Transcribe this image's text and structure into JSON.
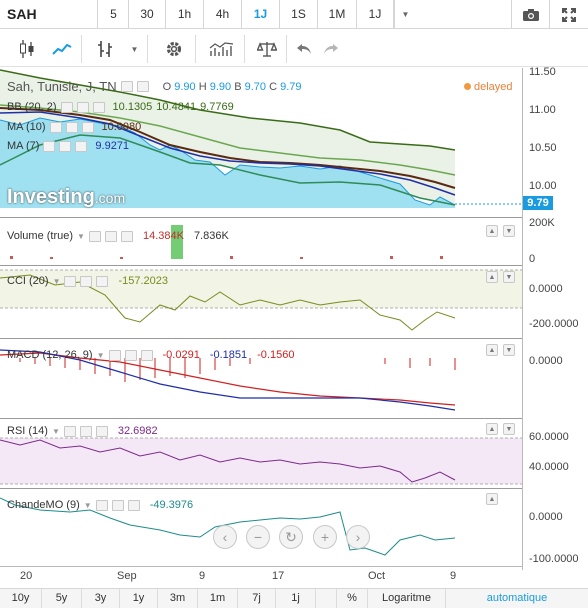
{
  "symbol": "SAH",
  "timeframes": [
    "5",
    "30",
    "1h",
    "4h",
    "1J",
    "1S",
    "1M",
    "1J"
  ],
  "active_timeframe_index": 4,
  "main": {
    "title": "Sah, Tunisie, J, TN",
    "ohlc": {
      "o_label": "O",
      "o": "9.90",
      "h_label": "H",
      "h": "9.90",
      "b_label": "B",
      "b": "9.70",
      "c_label": "C",
      "c": "9.79"
    },
    "delayed": "delayed",
    "bb_label": "BB (20, 2)",
    "bb_values": [
      "10.1305",
      "10.4841",
      "9.7769"
    ],
    "ma10_label": "MA (10)",
    "ma10_value": "10.0080",
    "ma7_label": "MA (7)",
    "ma7_value": "9.9271",
    "price_tag": "9.79",
    "logo_text": "Investing",
    "logo_suffix": ".com"
  },
  "volume": {
    "label": "Volume (true)",
    "value1": "14.384K",
    "value2": "7.836K"
  },
  "cci": {
    "label": "CCI (20)",
    "value": "-157.2023"
  },
  "macd": {
    "label": "MACD (12, 26, 9)",
    "values": [
      "-0.0291",
      "-0.1851",
      "-0.1560"
    ]
  },
  "rsi": {
    "label": "RSI (14)",
    "value": "32.6982"
  },
  "chandemo": {
    "label": "ChandeMO (9)",
    "value": "-49.3976"
  },
  "y_axis": {
    "main": [
      "11.50",
      "11.00",
      "10.50",
      "10.00"
    ],
    "volume": [
      "200K",
      "0"
    ],
    "cci": [
      "0.0000",
      "-200.0000"
    ],
    "macd": [
      "0.0000"
    ],
    "rsi": [
      "60.0000",
      "40.0000"
    ],
    "chandemo": [
      "0.0000",
      "-100.0000"
    ]
  },
  "x_axis": [
    "20",
    "Sep",
    "9",
    "17",
    "Oct",
    "9"
  ],
  "bottom": {
    "ranges": [
      "10y",
      "5y",
      "3y",
      "1y",
      "3m",
      "1m",
      "7j",
      "1j"
    ],
    "percent": "%",
    "log": "Logaritme",
    "auto": "automatique"
  },
  "colors": {
    "accent": "#1a9be0",
    "bb_line": "#3a6b17",
    "ma10": "#5a2b12",
    "ma7": "#1f2fa8",
    "area": "#8fdcee"
  }
}
